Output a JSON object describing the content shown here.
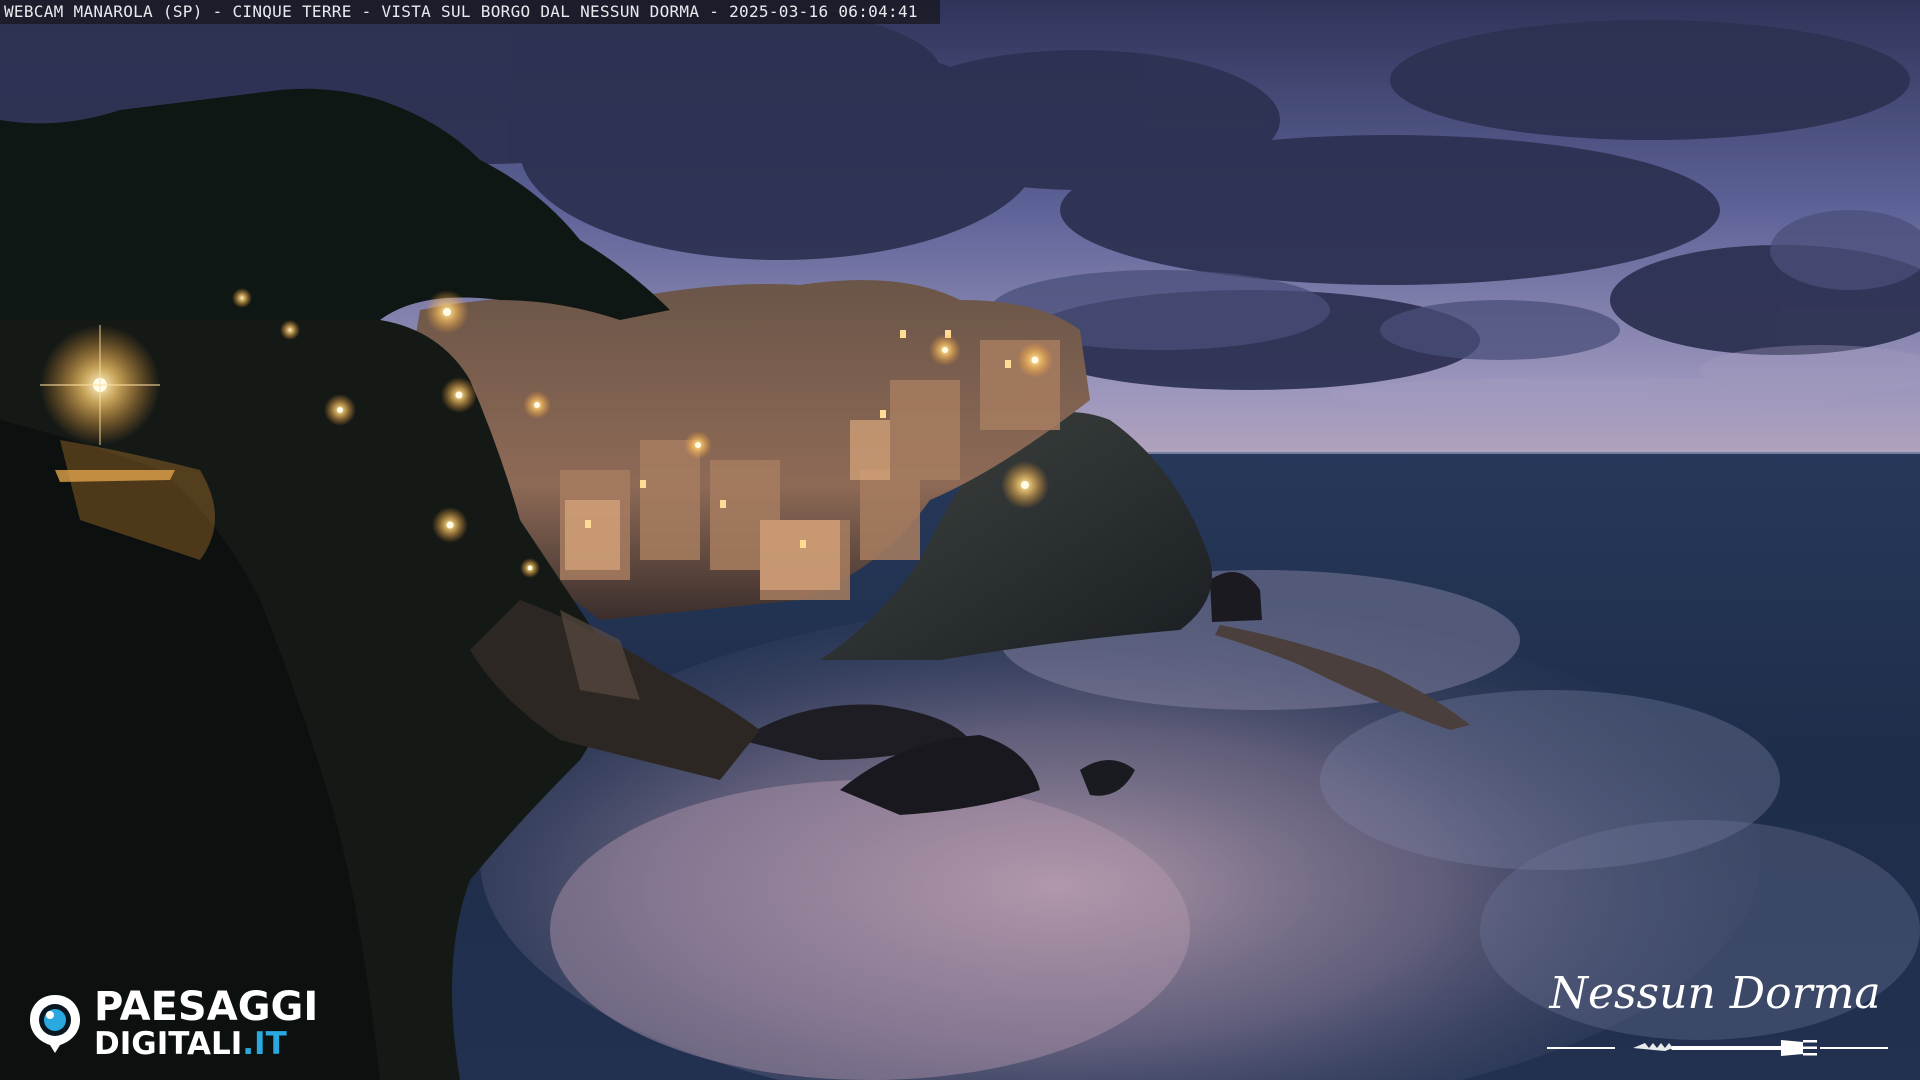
{
  "overlay": {
    "caption": "WEBCAM MANAROLA (SP) - CINQUE TERRE - VISTA SUL BORGO DAL NESSUN DORMA - 2025-03-16 06:04:41"
  },
  "logos": {
    "left_line1": "PAESAGGI",
    "left_line2": "DIGITALI",
    "left_tld": ".IT",
    "right_text": "Nessun Dorma"
  },
  "colors": {
    "sky_top": "#3a3f6b",
    "sky_horizon": "#8f8db4",
    "sea": "#1d2c45",
    "lamp": "#ffd27a",
    "brand_blue": "#29a9e0"
  }
}
